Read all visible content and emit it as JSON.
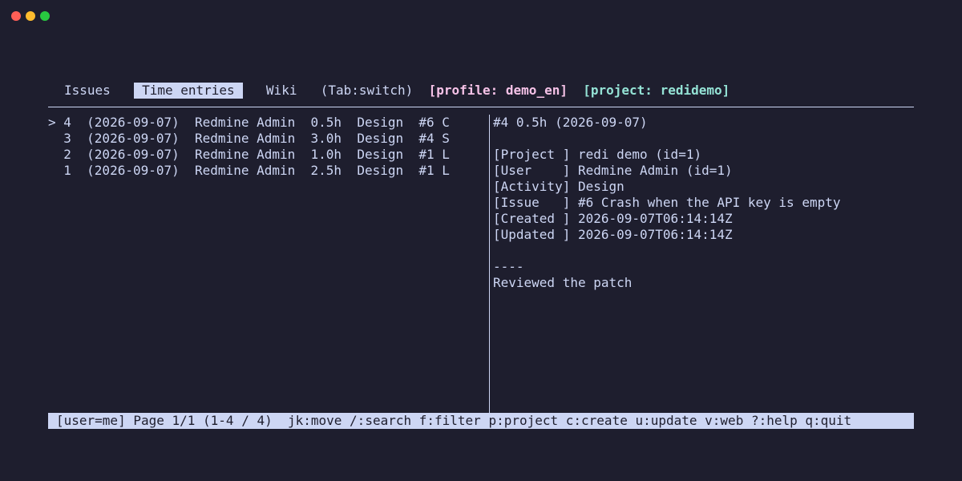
{
  "tabs": [
    {
      "label": "Issues",
      "active": false
    },
    {
      "label": "Time entries",
      "active": true
    },
    {
      "label": "Wiki",
      "active": false
    }
  ],
  "tab_hint": "(Tab:switch)",
  "profile_label": "[profile: demo_en]",
  "project_label": "[project: redidemo]",
  "entries": [
    {
      "text": "> 4  (2026-09-07)  Redmine Admin  0.5h  Design  #6 C",
      "selected": true
    },
    {
      "text": "  3  (2026-09-07)  Redmine Admin  3.0h  Design  #4 S",
      "selected": false
    },
    {
      "text": "  2  (2026-09-07)  Redmine Admin  1.0h  Design  #1 L",
      "selected": false
    },
    {
      "text": "  1  (2026-09-07)  Redmine Admin  2.5h  Design  #1 L",
      "selected": false
    }
  ],
  "detail": {
    "header": "#4 0.5h (2026-09-07)",
    "fields": [
      "[Project ] redi demo (id=1)",
      "[User    ] Redmine Admin (id=1)",
      "[Activity] Design",
      "[Issue   ] #6 Crash when the API key is empty",
      "[Created ] 2026-09-07T06:14:14Z",
      "[Updated ] 2026-09-07T06:14:14Z"
    ],
    "divider": "----",
    "comment": "Reviewed the patch"
  },
  "status_bar": "[user=me] Page 1/1 (1-4 / 4)  jk:move /:search f:filter p:project c:create u:update v:web ?:help q:quit",
  "colors": {
    "background": "#1e1e2e",
    "foreground": "#cdd6f4",
    "profile": "#f5c2e7",
    "project": "#94e2d5"
  }
}
